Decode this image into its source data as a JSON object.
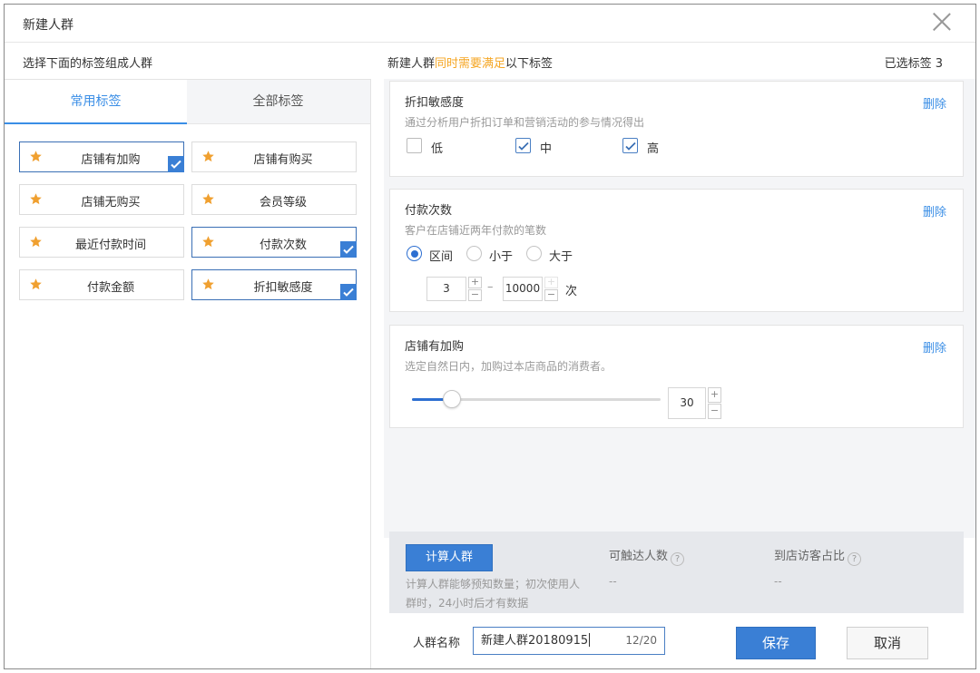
{
  "dialog": {
    "title": "新建人群"
  },
  "left": {
    "header": "选择下面的标签组成人群",
    "tabs": [
      "常用标签",
      "全部标签"
    ],
    "tags": [
      {
        "label": "店铺有加购",
        "selected": true
      },
      {
        "label": "店铺有购买",
        "selected": false
      },
      {
        "label": "店铺无购买",
        "selected": false
      },
      {
        "label": "会员等级",
        "selected": false
      },
      {
        "label": "最近付款时间",
        "selected": false
      },
      {
        "label": "付款次数",
        "selected": true
      },
      {
        "label": "付款金额",
        "selected": false
      },
      {
        "label": "折扣敏感度",
        "selected": true
      }
    ]
  },
  "right": {
    "header_pre": "新建人群",
    "header_hl": "同时需要满足",
    "header_post": "以下标签",
    "selected_count_label": "已选标签 3",
    "delete_label": "删除",
    "discount_card": {
      "title": "折扣敏感度",
      "desc": "通过分析用户折扣订单和营销活动的参与情况得出",
      "options": [
        {
          "label": "低",
          "checked": false
        },
        {
          "label": "中",
          "checked": true
        },
        {
          "label": "高",
          "checked": true
        }
      ]
    },
    "payment_card": {
      "title": "付款次数",
      "desc": "客户在店铺近两年付款的笔数",
      "modes": [
        {
          "label": "区间",
          "checked": true
        },
        {
          "label": "小于",
          "checked": false
        },
        {
          "label": "大于",
          "checked": false
        }
      ],
      "min": "3",
      "dash": "–",
      "max": "10000",
      "unit": "次"
    },
    "cart_card": {
      "title": "店铺有加购",
      "desc": "选定自然日内，加购过本店商品的消费者。",
      "value": "30",
      "slider_fraction": 0.16
    }
  },
  "calc": {
    "button": "计算人群",
    "hint": "计算人群能够预知数量；初次使用人群时，24小时后才有数据",
    "reach_label": "可触达人数",
    "reach_value": "--",
    "visit_label": "到店访客占比",
    "visit_value": "--",
    "help_glyph": "?"
  },
  "footer": {
    "name_label": "人群名称",
    "name_value": "新建人群20180915",
    "name_count": "12/20",
    "save": "保存",
    "cancel": "取消"
  },
  "stepper_glyphs": {
    "plus": "+",
    "minus": "−"
  },
  "colors": {
    "accent": "#3a7fd5",
    "highlight": "#f5a623",
    "star": "#f0a030"
  },
  "icons": {
    "tag": "star-icon",
    "check": "check-icon",
    "close": "close-icon",
    "help": "question-icon"
  }
}
